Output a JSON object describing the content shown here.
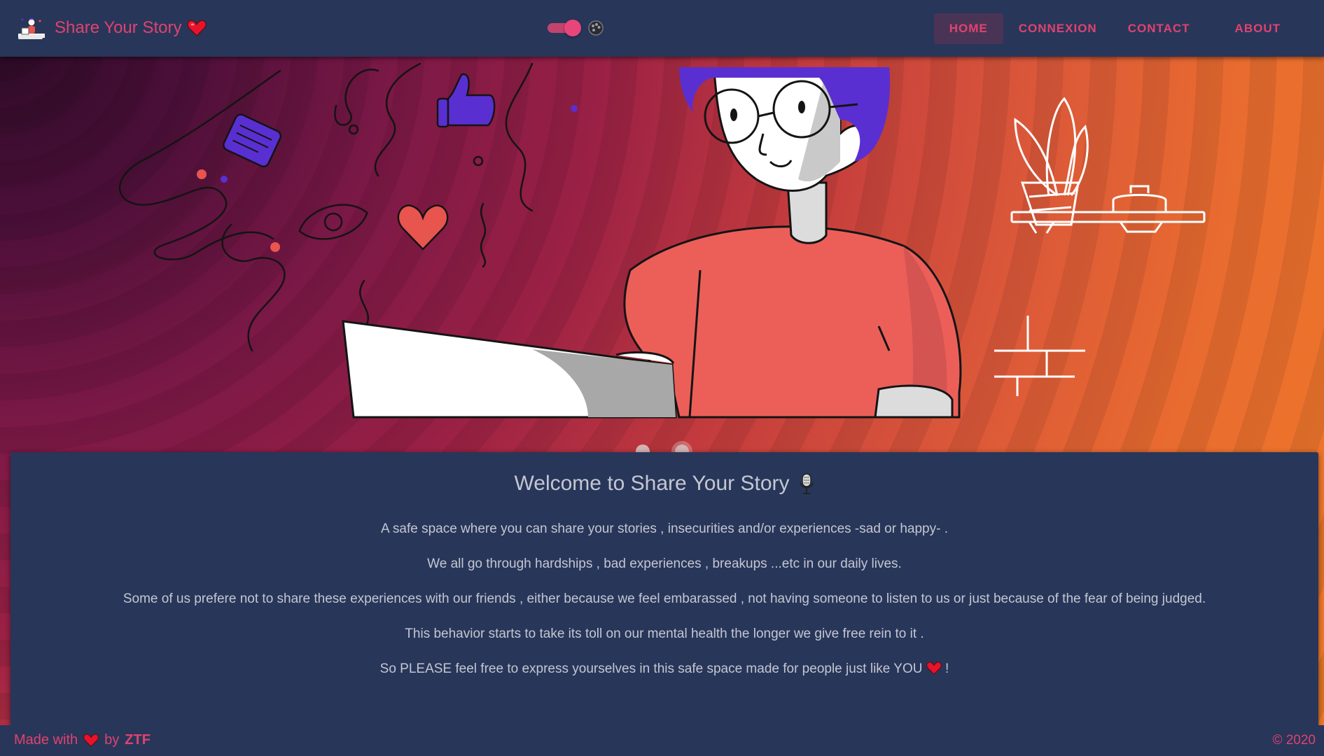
{
  "brand": {
    "name": "Share Your Story",
    "logo_icon": "laptop-person-icon",
    "heart_icon": "heart-icon"
  },
  "nav": {
    "items": [
      {
        "label": "HOME",
        "active": true
      },
      {
        "label": "CONNEXION",
        "active": false
      },
      {
        "label": "CONTACT",
        "active": false
      },
      {
        "label": "ABOUT",
        "active": false
      }
    ],
    "theme_toggle": {
      "on": true,
      "icon": "palette-icon"
    }
  },
  "carousel": {
    "slides": 2,
    "active_index": 1
  },
  "welcome": {
    "title": "Welcome to Share Your Story",
    "title_icon": "microphone-icon",
    "paragraphs": [
      "A safe space where you can share your stories , insecurities and/or experiences -sad or happy- .",
      "We all go through hardships , bad experiences , breakups ...etc in our daily lives.",
      "Some of us prefere not to share these experiences with our friends , either because we feel embarassed , not having someone to listen to us or just because of the fear of being judged.",
      "This behavior starts to take its toll on our mental health the longer we give free rein to it .",
      "So PLEASE feel free to express yourselves in this safe space made for people just like YOU"
    ],
    "last_suffix": "!"
  },
  "footer": {
    "made_with": "Made with",
    "by": "by",
    "author": "ZTF",
    "copyright": "© 2020"
  },
  "colors": {
    "accent": "#e0436f",
    "navbar_bg": "#28365a",
    "card_bg": "#28365a",
    "text_muted": "#c4c7d1"
  }
}
